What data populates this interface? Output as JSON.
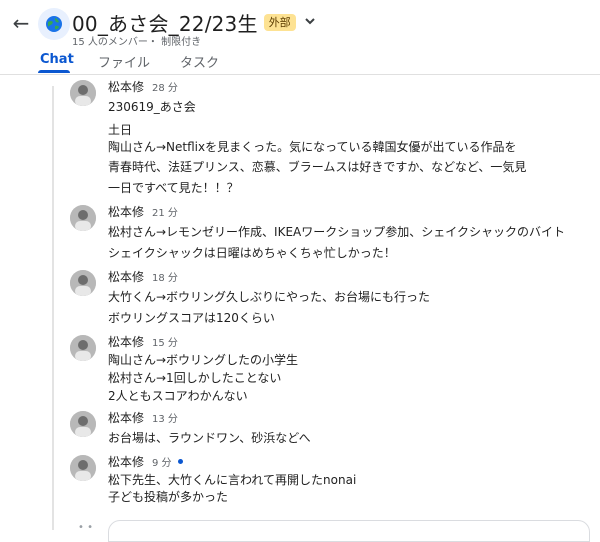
{
  "header": {
    "title": "00_あさ会_22/23生",
    "badge": "外部",
    "subtitle": "15 人のメンバー・ 制限付き",
    "back_icon": "arrow-back-icon",
    "space_icon": "globe-icon",
    "dropdown_icon": "chevron-down-icon"
  },
  "tabs": [
    {
      "label": "Chat",
      "active": true
    },
    {
      "label": "ファイル",
      "active": false
    },
    {
      "label": "タスク",
      "active": false
    }
  ],
  "messages": [
    {
      "author": "松本修",
      "time": "28 分",
      "lines": [
        "230619_あさ会",
        "土日",
        "陶山さん→Netflixを見まくった。気になっている韓国女優が出ている作品を",
        "青春時代、法廷プリンス、恋慕、ブラームスは好きですか、などなど、一気見",
        "一日ですべて見た！！？"
      ]
    },
    {
      "author": "松本修",
      "time": "21 分",
      "lines": [
        "松村さん→レモンゼリー作成、IKEAワークショップ参加、シェイクシャックのバイト",
        "シェイクシャックは日曜はめちゃくちゃ忙しかった！"
      ]
    },
    {
      "author": "松本修",
      "time": "18 分",
      "lines": [
        "大竹くん→ボウリング久しぶりにやった、お台場にも行った",
        "ボウリングスコアは120くらい"
      ]
    },
    {
      "author": "松本修",
      "time": "15 分",
      "lines": [
        "陶山さん→ボウリングしたの小学生",
        "松村さん→1回しかしたことない",
        "2人ともスコアわかんない"
      ]
    },
    {
      "author": "松本修",
      "time": "13 分",
      "lines": [
        "お台場は、ラウンドワン、砂浜などへ"
      ]
    },
    {
      "author": "松本修",
      "time": "9 分",
      "unread": true,
      "lines": [
        "松下先生、大竹くんに言われて再開したnonai",
        "子ども投稿が多かった"
      ]
    }
  ]
}
